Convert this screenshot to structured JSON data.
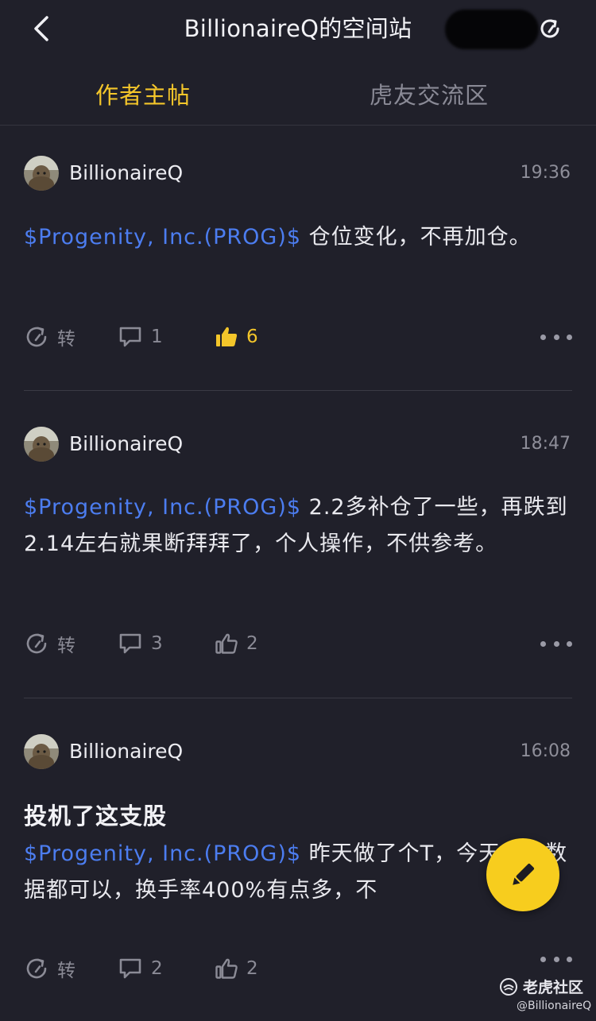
{
  "header": {
    "title": "BillionaireQ的空间站"
  },
  "tabs": [
    {
      "label": "作者主帖",
      "active": true
    },
    {
      "label": "虎友交流区",
      "active": false
    }
  ],
  "posts": [
    {
      "author": "BillionaireQ",
      "time": "19:36",
      "title": "",
      "ticker": "$Progenity, Inc.(PROG)$",
      "text": " 仓位变化，不再加仓。",
      "share_label": "转",
      "comments": "1",
      "likes": "6",
      "liked": true
    },
    {
      "author": "BillionaireQ",
      "time": "18:47",
      "title": "",
      "ticker": "$Progenity, Inc.(PROG)$",
      "text": " 2.2多补仓了一些，再跌到2.14左右就果断拜拜了，个人操作，不供参考。",
      "share_label": "转",
      "comments": "3",
      "likes": "2",
      "liked": false
    },
    {
      "author": "BillionaireQ",
      "time": "16:08",
      "title": "投机了这支股",
      "ticker": "$Progenity, Inc.(PROG)$",
      "text": " 昨天做了个T，今天交易数据都可以，换手率400%有点多，不",
      "share_label": "转",
      "comments": "2",
      "likes": "2",
      "liked": false
    }
  ],
  "watermark": {
    "brand": "老虎社区",
    "handle": "@BillionaireQ"
  },
  "colors": {
    "background": "#20202a",
    "accent": "#f4c62a",
    "ticker": "#4c7df0",
    "fab": "#f7cd1e"
  }
}
